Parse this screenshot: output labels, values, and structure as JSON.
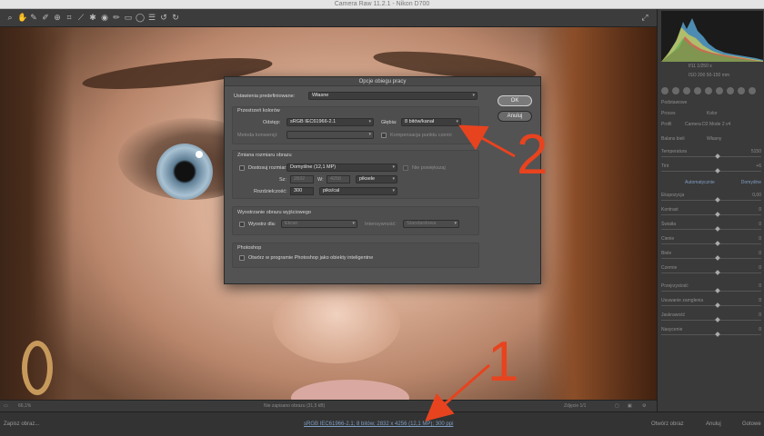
{
  "window": {
    "title": "Camera Raw 11.2.1  -  Nikon D700"
  },
  "toolbar": {
    "tools": [
      "zoom-icon",
      "hand-icon",
      "white-balance-icon",
      "color-sampler-icon",
      "target-adjust-icon",
      "crop-icon",
      "straighten-icon",
      "spot-removal-icon",
      "red-eye-icon",
      "adjustment-brush-icon",
      "graduated-filter-icon",
      "radial-filter-icon",
      "preferences-icon",
      "rotate-left-icon",
      "rotate-right-icon"
    ]
  },
  "photo_status": {
    "zoom": "66,1%",
    "center_text": "Nie zapisano obrazu (31,5 kB)",
    "right_text": "Zdjęcie 1/1"
  },
  "bottombar": {
    "save_label": "Zapisz obraz...",
    "workflow_link": "sRGB IEC61966-2.1; 8 bitów; 2832 x 4256 (12,1 MP); 300 ppi",
    "open_label": "Otwórz obraz",
    "cancel_label": "Anuluj",
    "done_label": "Gotowe"
  },
  "rightpanel": {
    "readout_top": "f/11   1/250 s",
    "readout_bottom": "ISO 200   50-150 mm",
    "section_label": "Podstawowe",
    "process_label": "Proces",
    "process_value": "Kolor",
    "profile_label": "Profil",
    "profile_value": "Camera D2 Mode 2 v4",
    "wb_label": "Balans bieli",
    "wb_value": "Własny",
    "sliders": [
      {
        "label": "Temperatura",
        "value": "5150"
      },
      {
        "label": "Tint",
        "value": "+6"
      },
      {
        "label": "Automatycznie",
        "value": "Domyślne"
      },
      {
        "label": "Ekspozycja",
        "value": "0,00"
      },
      {
        "label": "Kontrast",
        "value": "0"
      },
      {
        "label": "Światła",
        "value": "0"
      },
      {
        "label": "Cienie",
        "value": "0"
      },
      {
        "label": "Biele",
        "value": "0"
      },
      {
        "label": "Czernie",
        "value": "0"
      },
      {
        "label": "Przejrzystość",
        "value": "0"
      },
      {
        "label": "Usuwanie zamglenia",
        "value": "0"
      },
      {
        "label": "Jaskrawość",
        "value": "0"
      },
      {
        "label": "Nasycenie",
        "value": "0"
      }
    ]
  },
  "dialog": {
    "title": "Opcje obiegu pracy",
    "preset_label": "Ustawienia predefiniowane:",
    "preset_value": "Własne",
    "ok_label": "OK",
    "cancel_label": "Anuluj",
    "color_section": "Przestrzeń kolorów",
    "space_label": "Odstęp:",
    "space_value": "sRGB IEC61966-2.1",
    "depth_label": "Głębia:",
    "depth_value": "8 bitów/kanał",
    "intent_label": "Metoda konwersji:",
    "intent_value": "",
    "blackpoint_label": "Kompensacja punktu czerni",
    "resize_section": "Zmiana rozmiaru obrazu",
    "resize_check_label": "Dostosuj rozmiar:",
    "resize_value": "Domyślne (12,1 MP)",
    "no_enlarge_label": "Nie powiększaj",
    "w_label": "Sz:",
    "w_value": "2832",
    "h_label": "W:",
    "h_value": "4256",
    "unit_value": "piksele",
    "resolution_label": "Rozdzielczość:",
    "resolution_value": "300",
    "res_unit_value": "piks/cal",
    "sharpen_section": "Wyostrzanie obrazu wyjściowego",
    "sharpen_check_label": "Wyostrz dla:",
    "sharpen_value": "Ekran",
    "amount_label": "Intensywność:",
    "amount_value": "Standardowa",
    "ps_section": "Photoshop",
    "ps_check_label": "Otwórz w programie Photoshop jako obiekty inteligentne"
  },
  "annotations": {
    "label_1": "1",
    "label_2": "2",
    "arrow_color": "#e8431f"
  }
}
